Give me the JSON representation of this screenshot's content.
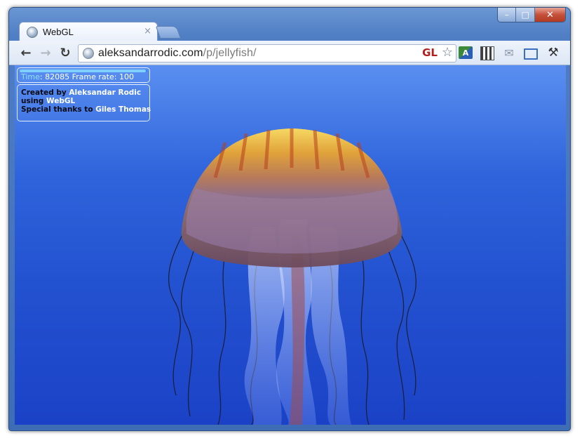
{
  "window": {
    "controls": {
      "minimize": "–",
      "maximize": "□",
      "close": "✕"
    }
  },
  "tabs": [
    {
      "title": "WebGL",
      "close_glyph": "×",
      "icon": "globe-icon"
    }
  ],
  "toolbar": {
    "back_glyph": "←",
    "forward_glyph": "→",
    "reload_glyph": "↻",
    "url_host": "aleksandarrodic.com",
    "url_path": "/p/jellyfish/",
    "gl_badge": "GL",
    "bookmark_glyph": "☆",
    "extensions": [
      "translate-icon",
      "qr-code-icon",
      "mail-icon",
      "fullscreen-icon",
      "wrench-icon"
    ],
    "translate_glyph": "A",
    "mail_glyph": "✉",
    "wrench_glyph": "⚒"
  },
  "stats": {
    "time_label": "Time",
    "time_value": ": 82085",
    "frame_rate_label": "Frame rate",
    "frame_rate_value": ": 100",
    "bar_fill_fraction": 0.99
  },
  "credits": {
    "created_by": "Created by ",
    "author": "Aleksandar Rodic",
    "using": "using ",
    "tech": "WebGL",
    "thanks": "Special thanks to ",
    "thanks_to": "Giles Thomas"
  },
  "colors": {
    "viewport_top": "#5a8ff0",
    "viewport_bottom": "#1b42c6",
    "bell_top": "#f2c84e",
    "bell_stripe": "#b8401c"
  }
}
